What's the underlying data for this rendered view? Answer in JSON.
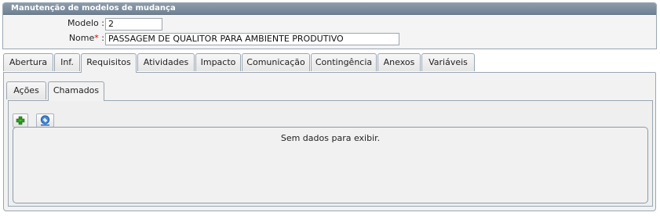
{
  "panel": {
    "title": "Manutenção de modelos de mudança",
    "fields": {
      "modelo_label": "Modelo :",
      "modelo_value": "2",
      "nome_label": "Nome",
      "nome_required": "*",
      "nome_colon": ":",
      "nome_value": "PASSAGEM DE QUALITOR PARA AMBIENTE PRODUTIVO"
    }
  },
  "tabs": [
    {
      "label": "Abertura"
    },
    {
      "label": "Inf."
    },
    {
      "label": "Requisitos",
      "active": true
    },
    {
      "label": "Atividades"
    },
    {
      "label": "Impacto"
    },
    {
      "label": "Comunicação"
    },
    {
      "label": "Contingência"
    },
    {
      "label": "Anexos"
    },
    {
      "label": "Variáveis"
    }
  ],
  "subtabs": [
    {
      "label": "Ações"
    },
    {
      "label": "Chamados",
      "active": true
    }
  ],
  "toolbar": {
    "add_icon": "add-icon",
    "link_icon": "link-icon"
  },
  "grid": {
    "empty_message": "Sem dados para exibir."
  },
  "colors": {
    "title_bar": "#7a8b9c",
    "required": "#d40000",
    "add_green": "#2e9a1e",
    "link_blue": "#2a6fc9"
  }
}
